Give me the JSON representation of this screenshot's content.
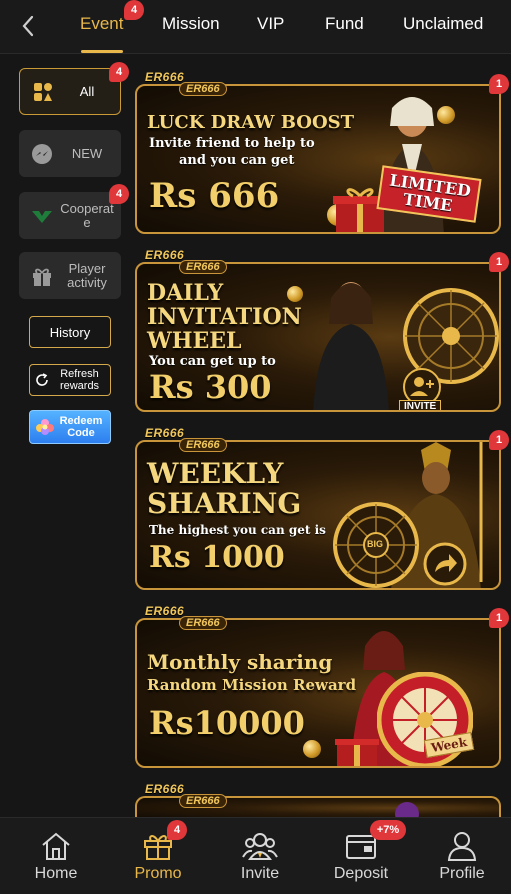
{
  "tabs": [
    {
      "label": "Event",
      "badge": "4"
    },
    {
      "label": "Mission"
    },
    {
      "label": "VIP"
    },
    {
      "label": "Fund"
    },
    {
      "label": "Unclaimed"
    }
  ],
  "sidebar": {
    "items": [
      {
        "label": "All",
        "badge": "4"
      },
      {
        "label": "NEW"
      },
      {
        "label": "Cooperate",
        "badge": "4"
      },
      {
        "label": "Player activity"
      }
    ],
    "history_label": "History",
    "refresh_label": "Refresh rewards",
    "redeem_label": "Redeem Code"
  },
  "banners": [
    {
      "logo": "ER666",
      "title": "LUCK DRAW BOOST",
      "sub1": "Invite friend to help to",
      "sub2": "and you can get",
      "currency": "Rs",
      "amount": "666",
      "tag": "LIMITED TIME",
      "badge": "1"
    },
    {
      "logo": "ER666",
      "title1": "DAILY",
      "title2": "INVITATION",
      "title3": "WHEEL",
      "sub1": "You can get up to",
      "currency": "Rs",
      "amount": "300",
      "tag": "INVITE",
      "badge": "1"
    },
    {
      "logo": "ER666",
      "title1": "WEEKLY",
      "title2": "SHARING",
      "sub1": "The highest you can get is",
      "currency": "Rs",
      "amount": "1000",
      "tag": "BIG",
      "badge": "1"
    },
    {
      "logo": "ER666",
      "title1": "Monthly sharing",
      "title2": "Random Mission Reward",
      "currency": "Rs",
      "amount": "10000",
      "tag": "Week",
      "badge": "1"
    }
  ],
  "bottom_nav": [
    {
      "label": "Home"
    },
    {
      "label": "Promo",
      "badge": "4"
    },
    {
      "label": "Invite"
    },
    {
      "label": "Deposit",
      "badge": "+7%"
    },
    {
      "label": "Profile"
    }
  ],
  "colors": {
    "accent": "#e8b84a",
    "badge": "#e0373b",
    "background": "#161616"
  }
}
